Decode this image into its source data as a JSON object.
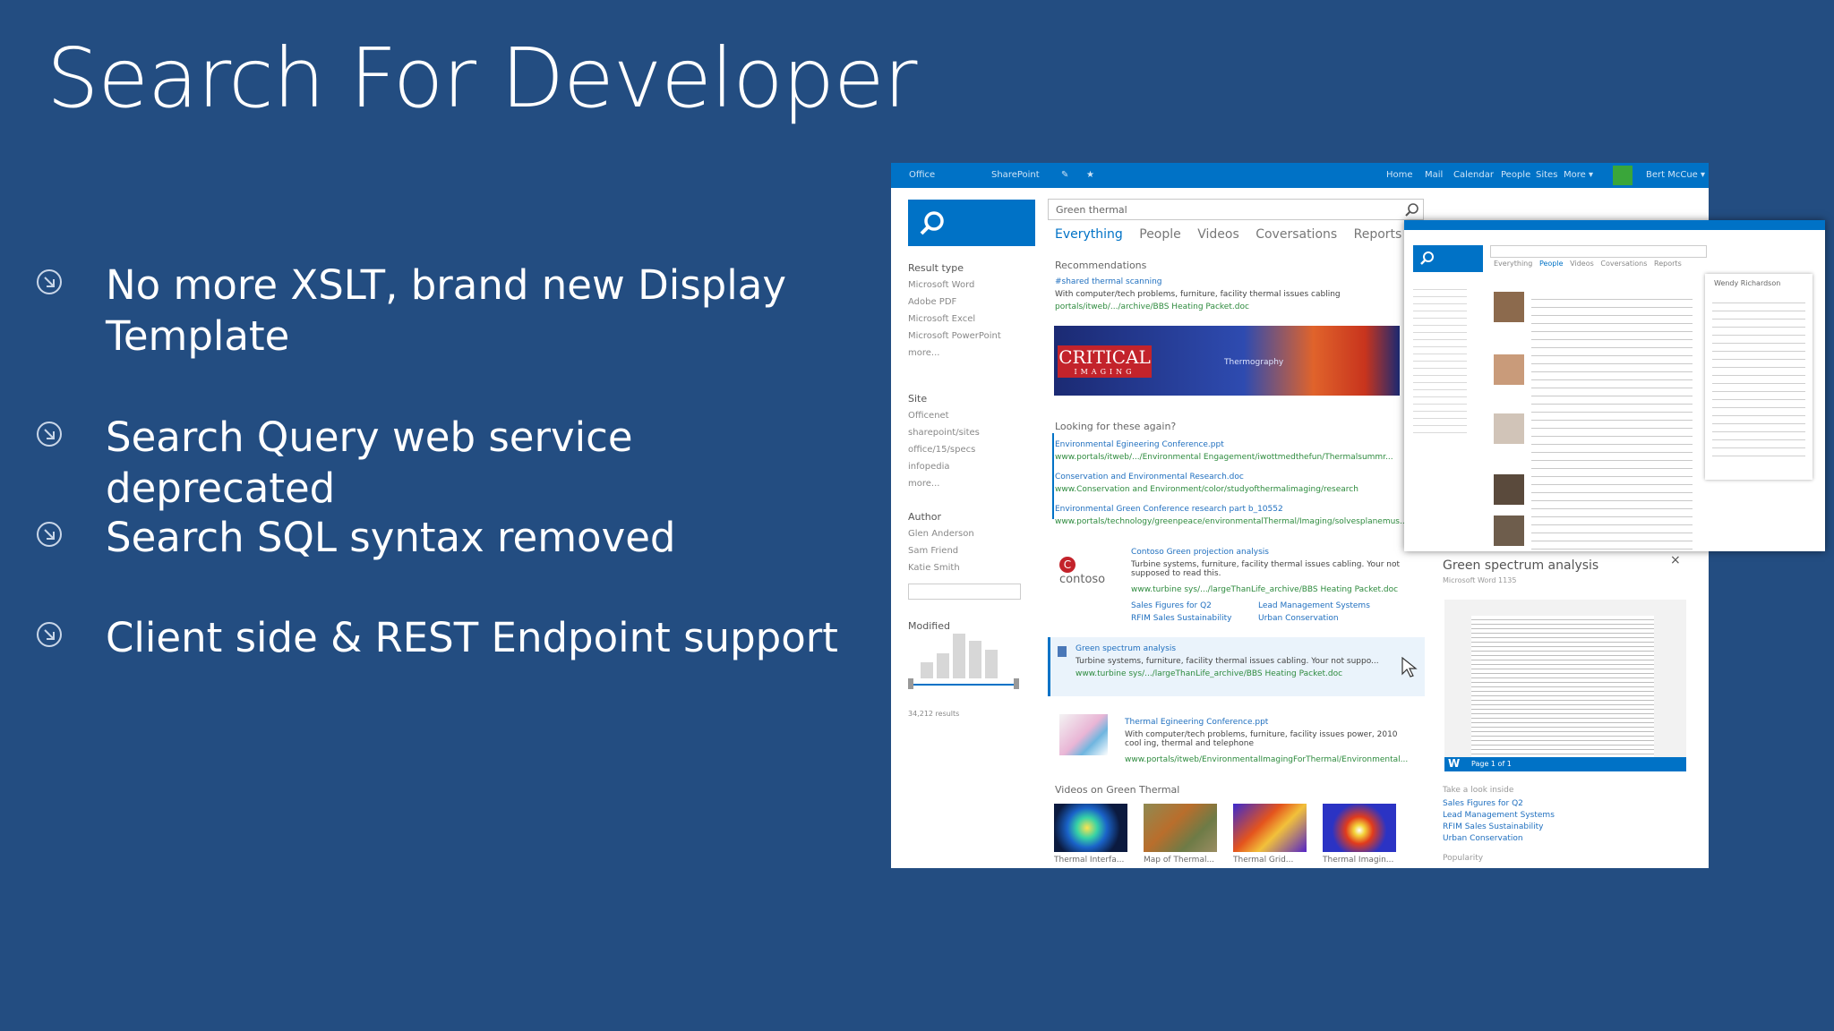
{
  "slide": {
    "title": "Search For Developer",
    "bullets": [
      {
        "text": "No more XSLT, brand new Display Template"
      },
      {
        "text": "Search Query web service deprecated"
      },
      {
        "text": "Search SQL syntax removed"
      },
      {
        "text": "Client side & REST Endpoint support"
      }
    ],
    "bullet_icon": "arrow-circle-icon"
  },
  "screenshot": {
    "suitebar": {
      "office": "Office",
      "sharepoint": "SharePoint",
      "nav": [
        "Home",
        "Mail",
        "Calendar",
        "People",
        "Sites",
        "More ▾"
      ],
      "user": "Bert McCue ▾"
    },
    "search_value": "Green thermal",
    "verticals": [
      "Everything",
      "People",
      "Videos",
      "Coversations",
      "Reports"
    ],
    "refiners": {
      "result_type": {
        "head": "Result type",
        "items": [
          "Microsoft Word",
          "Adobe PDF",
          "Microsoft Excel",
          "Microsoft PowerPoint",
          "more..."
        ]
      },
      "site": {
        "head": "Site",
        "items": [
          "Officenet",
          "sharepoint/sites",
          "office/15/specs",
          "infopedia",
          "more..."
        ]
      },
      "author": {
        "head": "Author",
        "items": [
          "Glen Anderson",
          "Sam Friend",
          "Katie Smith"
        ]
      },
      "modified": {
        "head": "Modified",
        "result_count": "34,212 results"
      }
    },
    "recommendations": {
      "head": "Recommendations",
      "link": "#shared thermal scanning",
      "desc": "With computer/tech problems, furniture, facility thermal issues cabling",
      "url": "portals/itweb/.../archive/BBS Heating Packet.doc",
      "banner_logo": "CRITICAL",
      "banner_sub": "IMAGING",
      "banner_tag": "Thermography"
    },
    "looking_again": {
      "head": "Looking for these again?",
      "items": [
        {
          "link": "Environmental Egineering Conference.ppt",
          "url": "www.portals/itweb/.../Environmental Engagement/iwottmedthefun/Thermalsummr..."
        },
        {
          "link": "Conservation and Environmental Research.doc",
          "url": "www.Conservation and Environment/color/studyofthermalimaging/research"
        },
        {
          "link": "Environmental Green Conference research part b_10552",
          "url": "www.portals/technology/greenpeace/environmentalThermal/Imaging/solvesplanemus..."
        }
      ]
    },
    "results": [
      {
        "link": "Contoso Green projection analysis",
        "desc": "Turbine systems, furniture, facility thermal issues cabling. Your not supposed to read this.",
        "url": "www.turbine sys/.../largeThanLife_archive/BBS Heating Packet.doc",
        "sublinks": [
          "Sales Figures for Q2",
          "Lead Management Systems",
          "RFIM Sales Sustainability",
          "Urban Conservation"
        ]
      },
      {
        "link": "Green spectrum analysis",
        "desc": "Turbine systems, furniture, facility thermal issues cabling. Your not suppo...",
        "url": "www.turbine sys/.../largeThanLife_archive/BBS Heating Packet.doc"
      },
      {
        "link": "Thermal Egineering Conference.ppt",
        "desc": "With computer/tech problems, furniture, facility issues power, 2010 cool ing, thermal and telephone",
        "url": "www.portals/itweb/EnvironmentalImagingForThermal/Environmental..."
      }
    ],
    "videos": {
      "head": "Videos on Green Thermal",
      "items": [
        "Thermal Interfa...",
        "Map of Thermal...",
        "Thermal Grid...",
        "Thermal Imagin..."
      ]
    },
    "hover": {
      "title": "Green spectrum analysis",
      "meta": "Microsoft Word 1135",
      "page": "Page 1 of 1",
      "look_inside": "Take a look inside",
      "links": [
        "Sales Figures for Q2",
        "Lead Management Systems",
        "RFIM Sales Sustainability",
        "Urban Conservation"
      ],
      "popularity": "Popularity"
    },
    "people": {
      "verticals": [
        "Everything",
        "People",
        "Videos",
        "Coversations",
        "Reports"
      ],
      "card_name": "Wendy Richardson"
    }
  }
}
